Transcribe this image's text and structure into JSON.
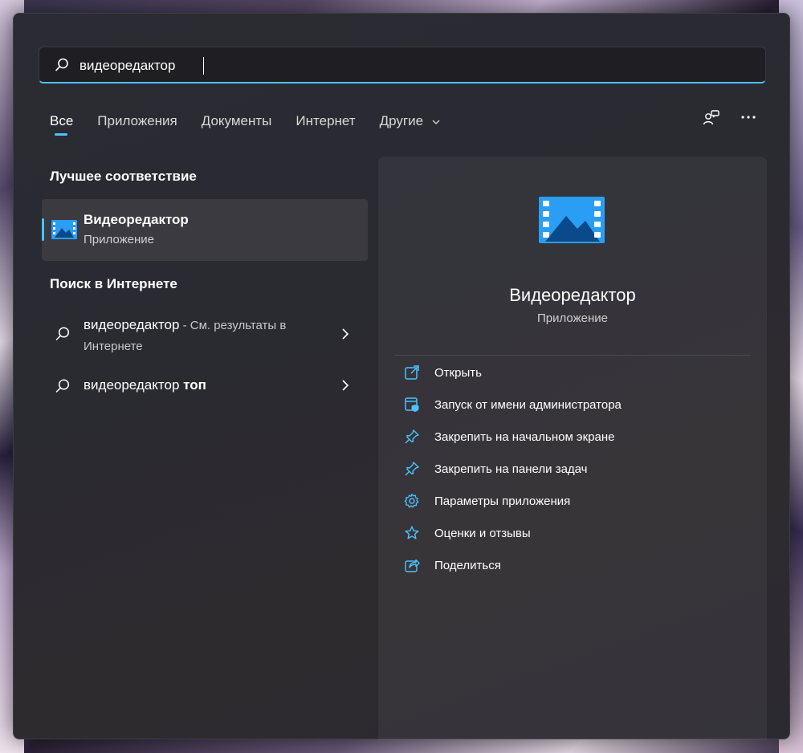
{
  "search": {
    "value": "видеоредактор",
    "icon": "search-icon"
  },
  "tabs": [
    {
      "label": "Все",
      "active": true
    },
    {
      "label": "Приложения"
    },
    {
      "label": "Документы"
    },
    {
      "label": "Интернет"
    },
    {
      "label": "Другие"
    }
  ],
  "best_match": {
    "title": "Лучшее соответствие",
    "app_name": "Видеоредактор",
    "app_type": "Приложение"
  },
  "web": {
    "title": "Поиск в Интернете",
    "items": [
      {
        "query": "видеоредактор",
        "suffix": " - См. результаты в Интернете"
      },
      {
        "query": "видеоредактор ",
        "bold": "топ"
      }
    ]
  },
  "details": {
    "app_name": "Видеоредактор",
    "app_type": "Приложение",
    "actions": [
      {
        "label": "Открыть",
        "icon": "open-external-icon"
      },
      {
        "label": "Запуск от имени администратора",
        "icon": "admin-shield-icon"
      },
      {
        "label": "Закрепить на начальном экране",
        "icon": "pin-icon"
      },
      {
        "label": "Закрепить на панели задач",
        "icon": "pin-icon"
      },
      {
        "label": "Параметры приложения",
        "icon": "gear-icon"
      },
      {
        "label": "Оценки и отзывы",
        "icon": "star-icon"
      },
      {
        "label": "Поделиться",
        "icon": "share-icon"
      }
    ]
  },
  "colors": {
    "accent": "#4cc2ff",
    "panel": "#2b2b33",
    "selected": "#3a3a40"
  }
}
